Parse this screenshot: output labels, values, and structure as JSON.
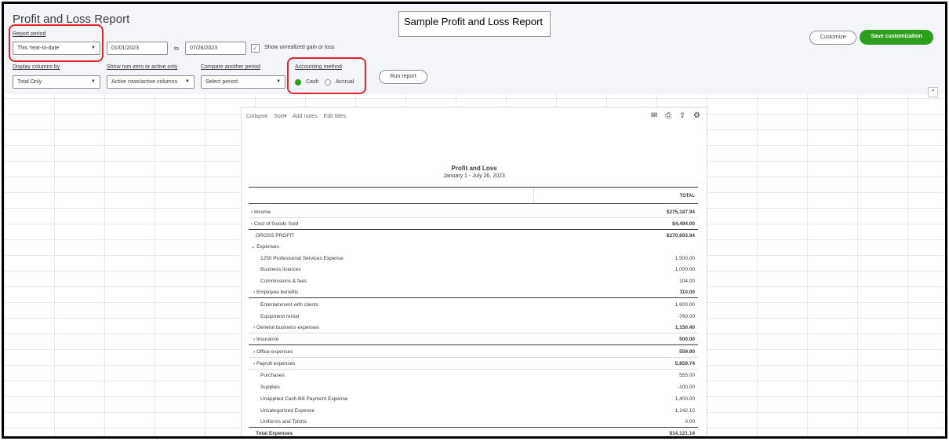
{
  "page": {
    "title": "Profit and Loss Report"
  },
  "callout": "Sample Profit and Loss Report",
  "filters": {
    "report_period_label": "Report period",
    "report_period_value": "This Year-to-date",
    "start_date": "01/01/2023",
    "to_label": "to",
    "end_date": "07/26/2023",
    "unrealized_label": "Show unrealized gain or loss",
    "display_columns_label": "Display columns by",
    "display_columns_value": "Total Only",
    "show_nonzero_label": "Show non-zero or active only",
    "show_nonzero_value": "Active rows/active columns",
    "compare_label": "Compare another period",
    "compare_value": "Select period",
    "accounting_label": "Accounting method",
    "cash_label": "Cash",
    "accrual_label": "Accrual",
    "run_report": "Run report"
  },
  "actions": {
    "customize": "Customize",
    "save": "Save customization"
  },
  "report": {
    "toolbar": [
      "Collapse",
      "Sort▾",
      "Add notes",
      "Edit titles"
    ],
    "title": "Profit and Loss",
    "subtitle": "January 1 - July 26, 2023",
    "total_header": "TOTAL",
    "rows": [
      {
        "label": "› Income",
        "value": "$275,187.94"
      },
      {
        "label": "› Cost of Goods Sold",
        "value": "$4,494.00"
      },
      {
        "label": "GROSS PROFIT",
        "value": "$270,693.94"
      },
      {
        "label": "⌄ Expenses",
        "value": ""
      },
      {
        "label": "1250 Professional Services Expense",
        "value": "1,500.00"
      },
      {
        "label": "Business licences",
        "value": "1,000.00"
      },
      {
        "label": "Commissions & fees",
        "value": "104.00"
      },
      {
        "label": "› Employee benefits",
        "value": "110.00"
      },
      {
        "label": "Entertainment with clients",
        "value": "1,600.00"
      },
      {
        "label": "Equipment rental",
        "value": "-760.00"
      },
      {
        "label": "› General business expenses",
        "value": "1,150.40"
      },
      {
        "label": "› Insurance",
        "value": "500.00"
      },
      {
        "label": "› Office expenses",
        "value": "559.90"
      },
      {
        "label": "› Payroll expenses",
        "value": "5,859.74"
      },
      {
        "label": "Purchases",
        "value": "555.00"
      },
      {
        "label": "Supplies",
        "value": "-100.00"
      },
      {
        "label": "Unapplied Cash Bill Payment Expense",
        "value": "1,400.00"
      },
      {
        "label": "Uncategorized Expense",
        "value": "1,142.10"
      },
      {
        "label": "Uniforms and Tshirts",
        "value": "0.00"
      },
      {
        "label": "Total Expenses",
        "value": "$14,121.14"
      }
    ]
  },
  "colors": {
    "accent_green": "#2ca01c",
    "highlight_red": "#e0242e"
  }
}
